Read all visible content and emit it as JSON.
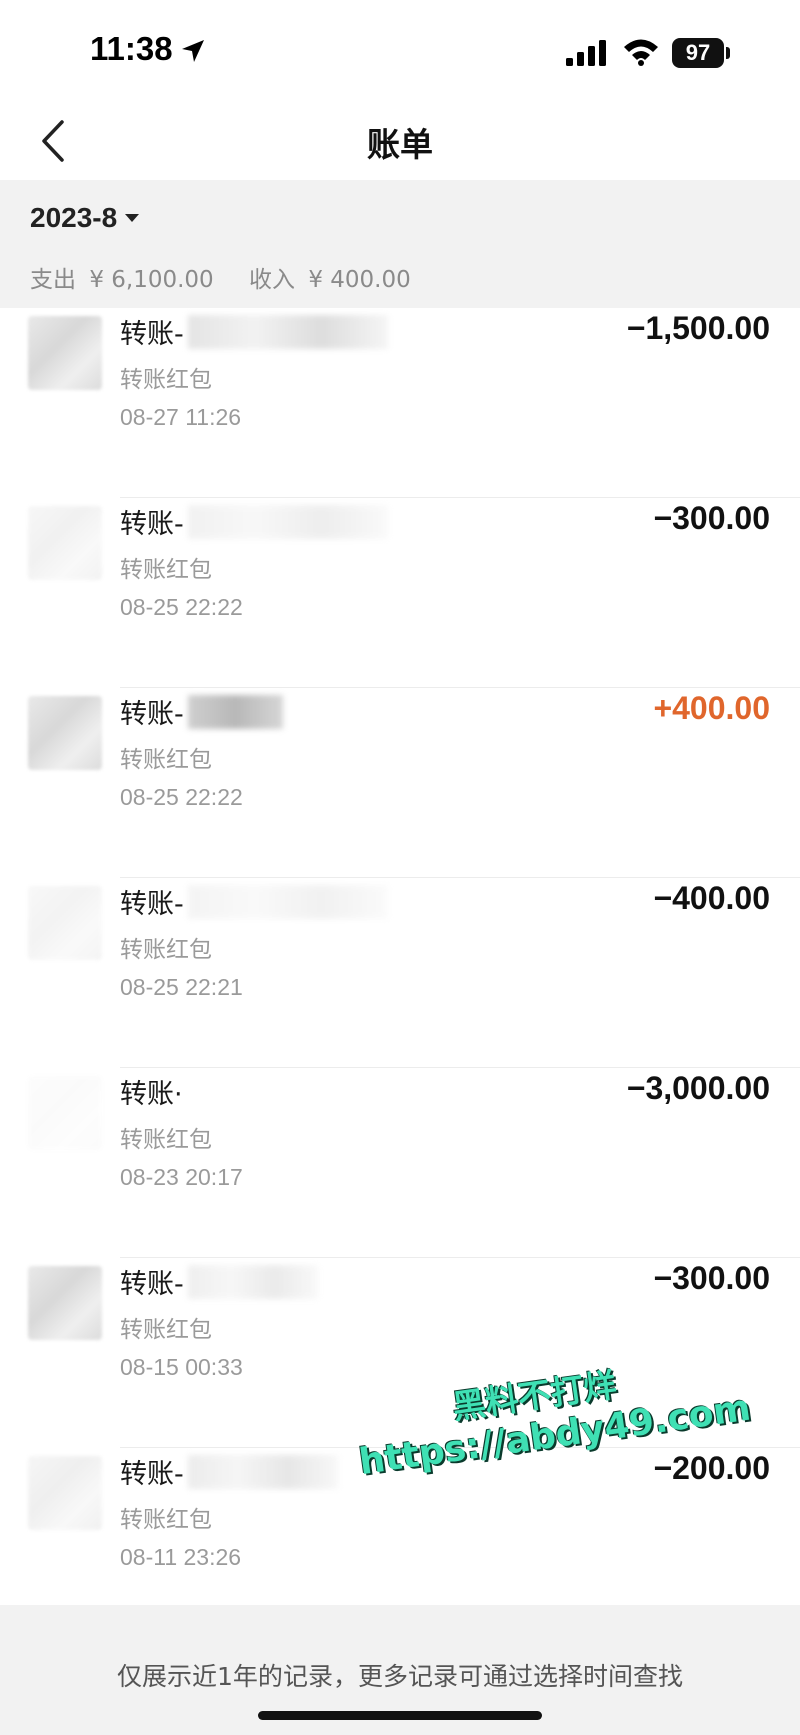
{
  "status_bar": {
    "time": "11:38",
    "battery": "97"
  },
  "nav": {
    "title": "账单",
    "back_icon": "chevron-left-icon"
  },
  "header": {
    "month": "2023-8",
    "expense_label": "支出",
    "expense_value": "¥ 6,100.00",
    "income_label": "收入",
    "income_value": "¥ 400.00"
  },
  "transactions": [
    {
      "title": "转账-",
      "subtitle": "转账红包",
      "time": "08-27  11:26",
      "amount": "−1,500.00",
      "type": "expense"
    },
    {
      "title": "转账-",
      "subtitle": "转账红包",
      "time": "08-25  22:22",
      "amount": "−300.00",
      "type": "expense"
    },
    {
      "title": "转账-",
      "subtitle": "转账红包",
      "time": "08-25  22:22",
      "amount": "+400.00",
      "type": "income"
    },
    {
      "title": "转账-",
      "subtitle": "转账红包",
      "time": "08-25  22:21",
      "amount": "−400.00",
      "type": "expense"
    },
    {
      "title": "转账·",
      "subtitle": "转账红包",
      "time": "08-23  20:17",
      "amount": "−3,000.00",
      "type": "expense"
    },
    {
      "title": "转账-",
      "subtitle": "转账红包",
      "time": "08-15  00:33",
      "amount": "−300.00",
      "type": "expense"
    },
    {
      "title": "转账-",
      "subtitle": "转账红包",
      "time": "08-11  23:26",
      "amount": "−200.00",
      "type": "expense"
    }
  ],
  "footer": {
    "note": "仅展示近1年的记录，更多记录可通过选择时间查找"
  },
  "watermark": {
    "line1": "黑料不打烊",
    "line2": "https://abdy49.com"
  },
  "colors": {
    "income": "#e0662c",
    "expense": "#111111",
    "header_bg": "#f2f2f2"
  }
}
